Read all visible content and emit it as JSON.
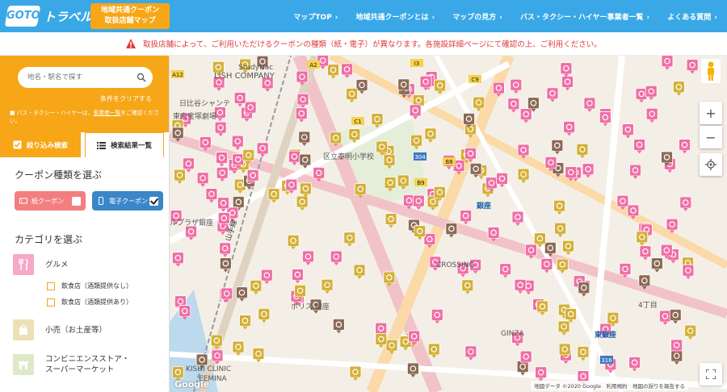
{
  "header": {
    "logo_badge": "GOTO",
    "logo_text": "トラベル",
    "map_button_line1": "地域共通クーポン",
    "map_button_line2": "取扱店舗マップ",
    "nav": [
      {
        "label": "マップTOP"
      },
      {
        "label": "地域共通クーポンとは"
      },
      {
        "label": "マップの見方"
      },
      {
        "label": "バス・タクシー・ハイヤー事業者一覧"
      },
      {
        "label": "よくある質問"
      }
    ],
    "nav_chevron": "›"
  },
  "notice": {
    "text": "取扱店舗によって、ご利用いただけるクーポンの種類（紙・電子）が異なります。各施設詳細ページにて確認の上、ご利用ください。",
    "icon": "warning-icon",
    "color": "#e03a3a"
  },
  "sidebar": {
    "search_placeholder": "地名・駅名で探す",
    "clear_label": "条件をクリアする",
    "bus_note_prefix": "■ バス・タクシー・ハイヤーは、",
    "bus_note_link": "事業者一覧",
    "bus_note_suffix": "をご確認ください。",
    "tab_filter": "絞り込み検索",
    "tab_results": "検索結果一覧",
    "coupon_section_title": "クーポン種類を選ぶ",
    "coupon_paper": "紙クーポン",
    "coupon_paper_checked": false,
    "coupon_electronic": "電子クーポン",
    "coupon_electronic_checked": true,
    "category_section_title": "カテゴリを選ぶ",
    "categories": [
      {
        "label": "グルメ",
        "icon": "fork-knife-icon",
        "color": "#f7a8c8"
      },
      {
        "label": "小売（お土産等）",
        "icon": "shopping-bag-icon",
        "color": "#ede0b4"
      },
      {
        "label_line1": "コンビニエンスストア・",
        "label_line2": "スーパーマーケット",
        "icon": "store-icon",
        "color": "#dfe9c9"
      }
    ],
    "gourmet_options": [
      {
        "label": "飲食店（酒類提供なし）",
        "checked": false
      },
      {
        "label": "飲食店（酒類提供あり）",
        "checked": false
      }
    ]
  },
  "map": {
    "labels": [
      "StudyHac",
      "LISH COMPANY",
      "日比谷シャンテ",
      "東京宝塚劇場",
      "区立泰明小学校",
      "銀座",
      "ルプラザ銀座",
      "山手線",
      "ポリス 銀座",
      "ヨウ リン",
      "銀座 9",
      "CROSSING",
      "GINZA",
      "東銀座",
      "歌舞伎座",
      "4丁目",
      "ステーキ　アメ",
      "コ銀座",
      "グランマ",
      "EEMINA",
      "KISHI CLINIC",
      "椿屋"
    ],
    "station_label": "銀座",
    "higashi_ginza": "東銀座",
    "route_labels": [
      "A2",
      "A12",
      "C1",
      "B8",
      "B9",
      "C9",
      "I3",
      "304",
      "316"
    ],
    "zoom_in": "+",
    "zoom_out": "−",
    "google_logo": "Google",
    "attribution": "地図データ ©2020 Google　利用規約　地図の誤りを報告する",
    "pin_colors": {
      "gourmet": "#f06ea5",
      "retail": "#d4b036",
      "service": "#8c6a55"
    }
  }
}
